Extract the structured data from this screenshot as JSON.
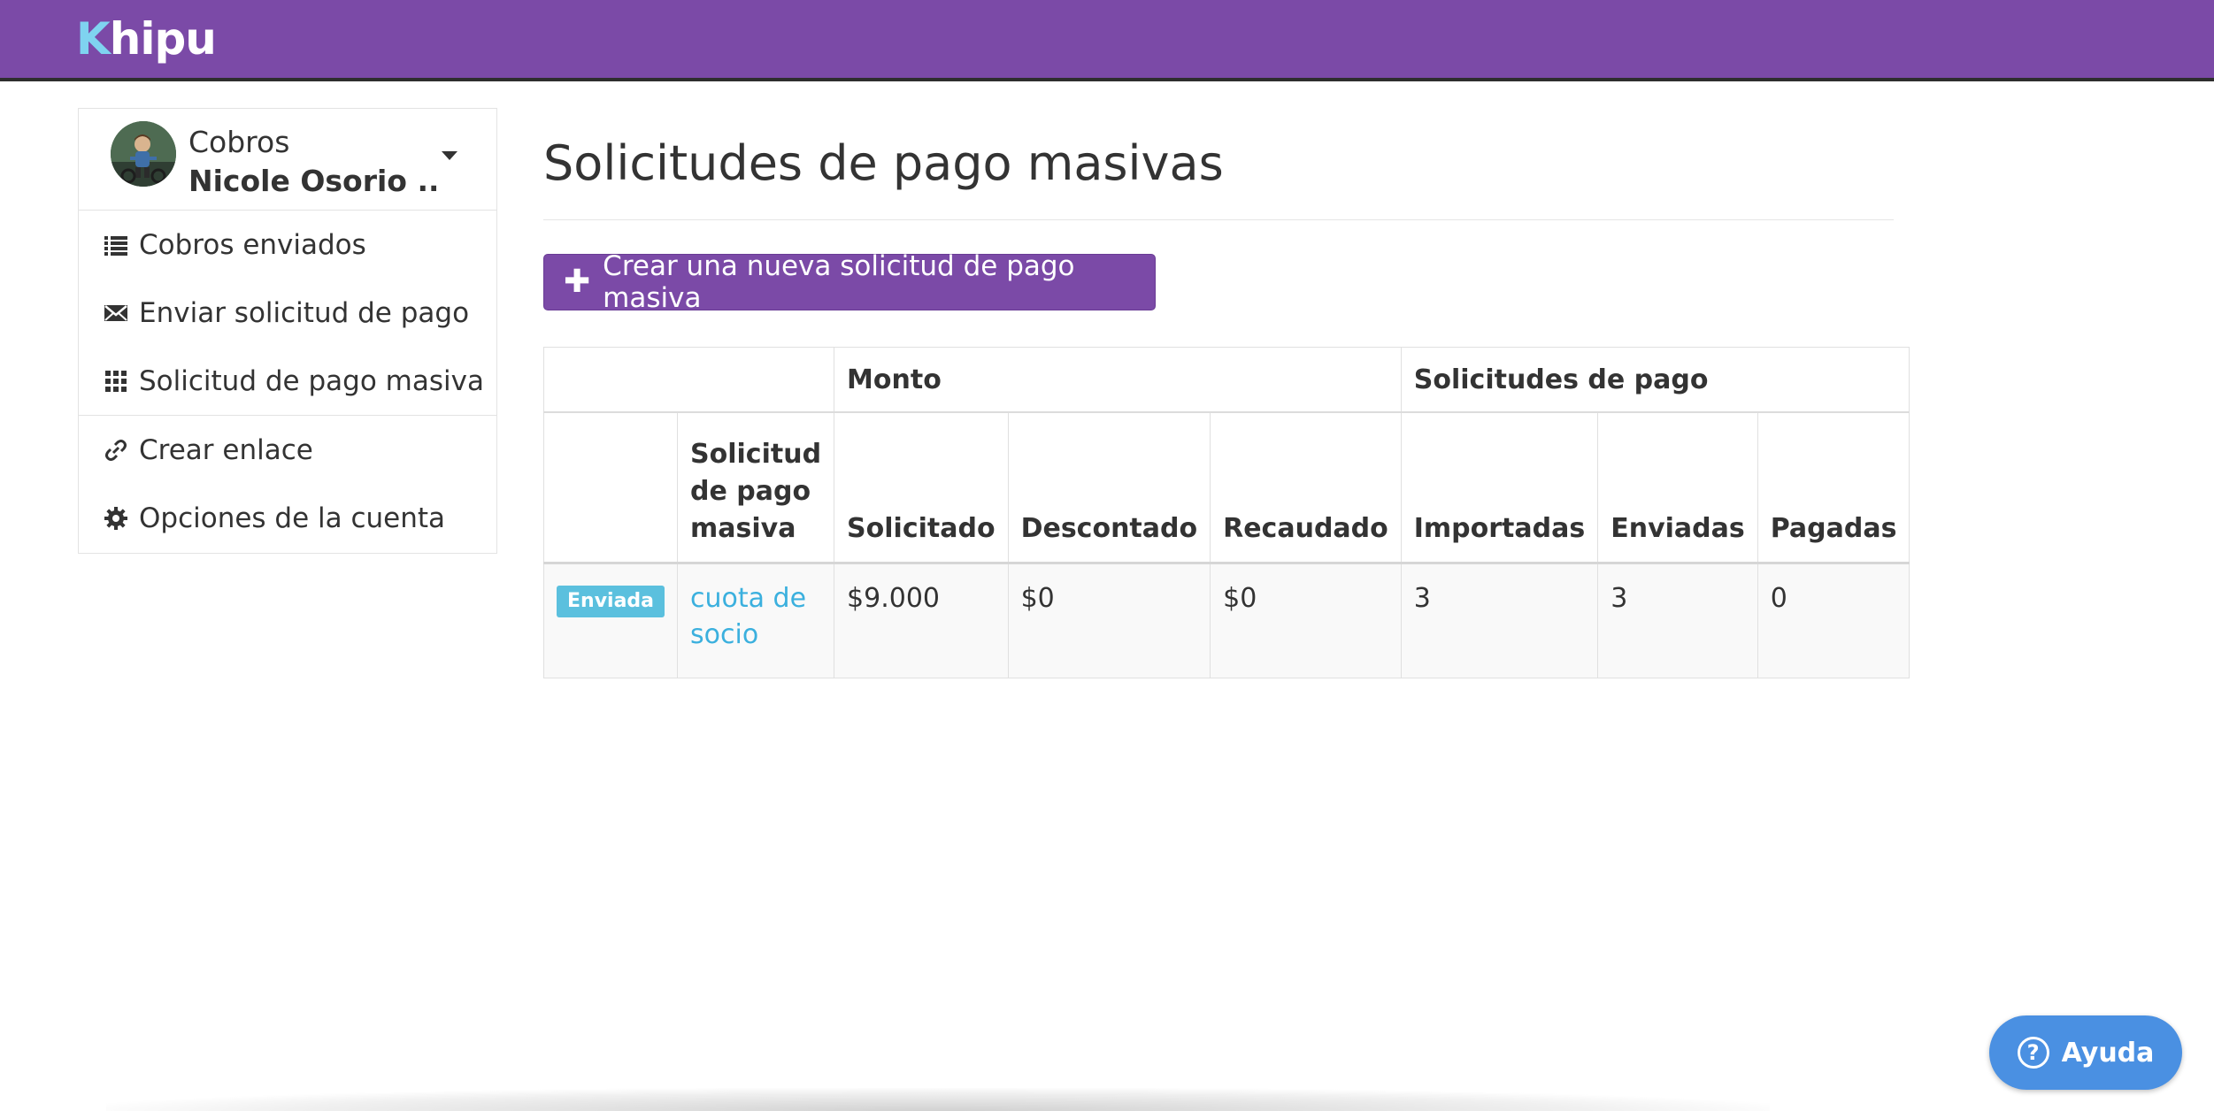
{
  "brand": {
    "logo_first": "K",
    "logo_rest": "hipu",
    "bar_color": "#7b4aa7"
  },
  "sidebar": {
    "account": {
      "app": "Cobros",
      "user": "Nicole Osorio ..."
    },
    "items": [
      {
        "label": "Cobros enviados",
        "icon": "list-icon"
      },
      {
        "label": "Enviar solicitud de pago",
        "icon": "envelope-icon"
      },
      {
        "label": "Solicitud de pago masiva",
        "icon": "grid-icon"
      },
      {
        "label": "Crear enlace",
        "icon": "link-icon"
      },
      {
        "label": "Opciones de la cuenta",
        "icon": "gear-icon"
      }
    ]
  },
  "main": {
    "title": "Solicitudes de pago masivas",
    "create_button": "Crear una nueva solicitud de pago masiva",
    "table": {
      "group_headers": {
        "monto": "Monto",
        "solicitudes": "Solicitudes de pago"
      },
      "columns": [
        "",
        "Solicitud de pago masiva",
        "Solicitado",
        "Descontado",
        "Recaudado",
        "Importadas",
        "Enviadas",
        "Pagadas"
      ],
      "rows": [
        {
          "status": "Enviada",
          "name": "cuota de socio",
          "solicitado": "$9.000",
          "descontado": "$0",
          "recaudado": "$0",
          "importadas": "3",
          "enviadas": "3",
          "pagadas": "0"
        }
      ]
    }
  },
  "help": {
    "label": "Ayuda"
  },
  "colors": {
    "accent": "#7b4aa7",
    "badge": "#5bc0de",
    "link": "#3bb0de",
    "help": "#4a90e2"
  }
}
